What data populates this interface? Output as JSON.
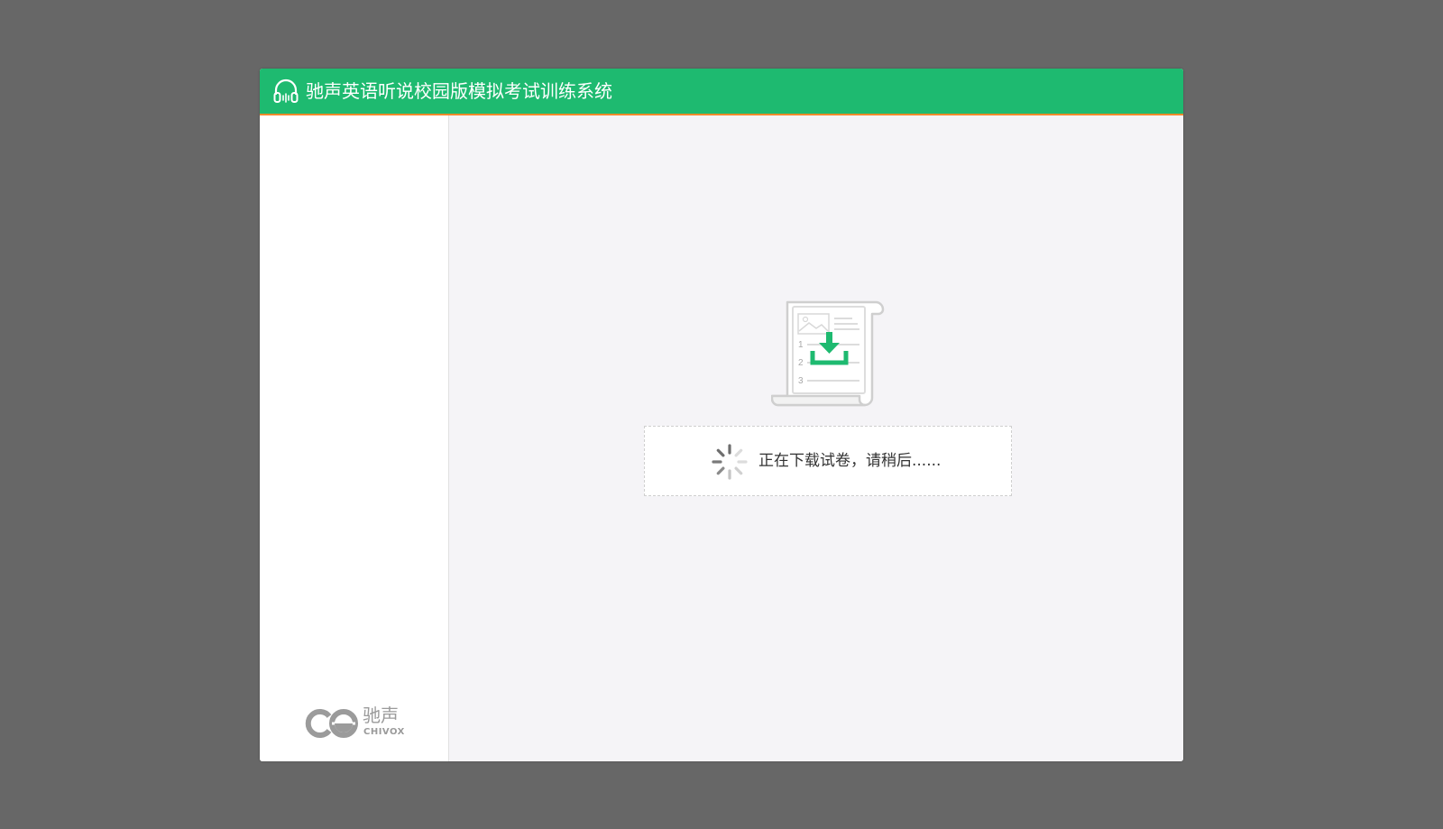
{
  "window": {
    "title": "驰声英语听说校园版模拟考试训练系统",
    "title_icon": "headphones-icon"
  },
  "sidebar": {
    "brand_cn": "驰声",
    "brand_en": "CHIVOX",
    "logo_icon": "chivox-logo"
  },
  "main": {
    "illustration_icon": "exam-paper-download-icon",
    "paper_numbers": [
      "1",
      "2",
      "3"
    ],
    "status_text": "正在下载试卷，请稍后......",
    "spinner_icon": "loading-spinner-icon"
  },
  "colors": {
    "title_bar": "#1eba70",
    "title_border": "#f08a2b",
    "backdrop": "#676767",
    "main_bg": "#f5f4f7"
  }
}
